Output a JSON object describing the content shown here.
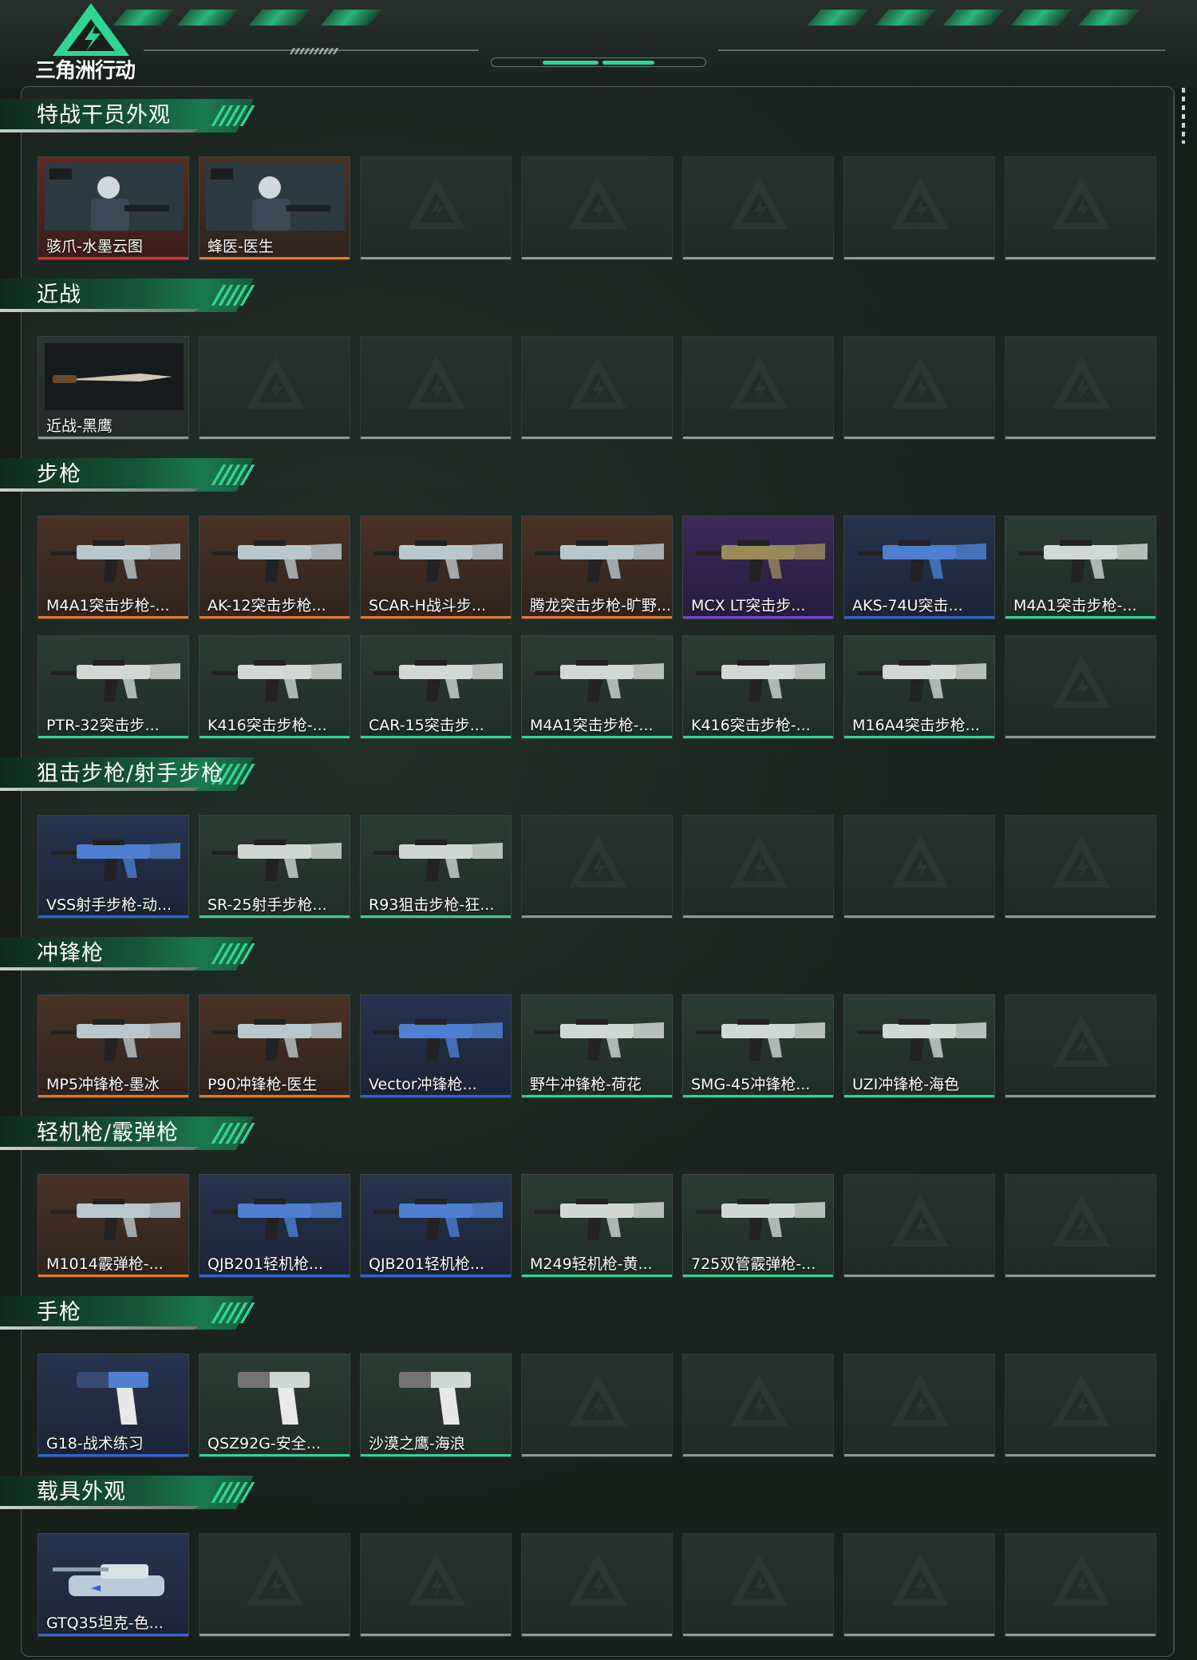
{
  "app": {
    "logo_text": "三角洲行动"
  },
  "colors": {
    "accent": "#2fd693",
    "rarity_red": "#d8302a",
    "rarity_orange": "#e8782a",
    "rarity_purple": "#7b3fe0",
    "rarity_blue": "#2a64d8",
    "rarity_green": "#2fd693",
    "rarity_gray": "#8e9894"
  },
  "sections": [
    {
      "title": "特战干员外观",
      "items": [
        {
          "label": "骇爪-水墨云图",
          "rarity": "red",
          "icon": "operator-portrait-icon"
        },
        {
          "label": "蜂医-医生",
          "rarity": "orange",
          "icon": "operator-portrait-icon"
        }
      ]
    },
    {
      "title": "近战",
      "items": [
        {
          "label": "近战-黑鹰",
          "rarity": "gray",
          "icon": "knife-icon"
        }
      ]
    },
    {
      "title": "步枪",
      "items": [
        {
          "label": "M4A1突击步枪-...",
          "rarity": "orange",
          "icon": "rifle-icon"
        },
        {
          "label": "AK-12突击步枪...",
          "rarity": "orange",
          "icon": "rifle-icon"
        },
        {
          "label": "SCAR-H战斗步...",
          "rarity": "orange",
          "icon": "rifle-icon"
        },
        {
          "label": "腾龙突击步枪-旷野...",
          "rarity": "orange",
          "icon": "rifle-icon"
        },
        {
          "label": "MCX LT突击步...",
          "rarity": "purple",
          "icon": "rifle-icon"
        },
        {
          "label": "AKS-74U突击...",
          "rarity": "blue",
          "icon": "rifle-icon"
        },
        {
          "label": "M4A1突击步枪-...",
          "rarity": "green",
          "icon": "rifle-icon"
        },
        {
          "label": "PTR-32突击步...",
          "rarity": "green",
          "icon": "rifle-icon"
        },
        {
          "label": "K416突击步枪-...",
          "rarity": "green",
          "icon": "rifle-icon"
        },
        {
          "label": "CAR-15突击步...",
          "rarity": "green",
          "icon": "rifle-icon"
        },
        {
          "label": "M4A1突击步枪-...",
          "rarity": "green",
          "icon": "rifle-icon"
        },
        {
          "label": "K416突击步枪-...",
          "rarity": "green",
          "icon": "rifle-icon"
        },
        {
          "label": "M16A4突击步枪...",
          "rarity": "green",
          "icon": "rifle-icon"
        }
      ]
    },
    {
      "title": "狙击步枪/射手步枪",
      "items": [
        {
          "label": "VSS射手步枪-动...",
          "rarity": "blue",
          "icon": "sniper-icon"
        },
        {
          "label": "SR-25射手步枪...",
          "rarity": "green",
          "icon": "sniper-icon"
        },
        {
          "label": "R93狙击步枪-狂...",
          "rarity": "green",
          "icon": "sniper-icon"
        }
      ]
    },
    {
      "title": "冲锋枪",
      "items": [
        {
          "label": "MP5冲锋枪-墨冰",
          "rarity": "orange",
          "icon": "smg-icon"
        },
        {
          "label": "P90冲锋枪-医生",
          "rarity": "orange",
          "icon": "smg-icon"
        },
        {
          "label": "Vector冲锋枪...",
          "rarity": "blue",
          "icon": "smg-icon"
        },
        {
          "label": "野牛冲锋枪-荷花",
          "rarity": "green",
          "icon": "smg-icon"
        },
        {
          "label": "SMG-45冲锋枪...",
          "rarity": "green",
          "icon": "smg-icon"
        },
        {
          "label": "UZI冲锋枪-海色",
          "rarity": "green",
          "icon": "smg-icon"
        }
      ]
    },
    {
      "title": "轻机枪/霰弹枪",
      "items": [
        {
          "label": "M1014霰弹枪-...",
          "rarity": "orange",
          "icon": "shotgun-icon"
        },
        {
          "label": "QJB201轻机枪...",
          "rarity": "blue",
          "icon": "lmg-icon"
        },
        {
          "label": "QJB201轻机枪...",
          "rarity": "blue",
          "icon": "lmg-icon"
        },
        {
          "label": "M249轻机枪-黄...",
          "rarity": "green",
          "icon": "lmg-icon"
        },
        {
          "label": "725双管霰弹枪-...",
          "rarity": "green",
          "icon": "shotgun-icon"
        }
      ]
    },
    {
      "title": "手枪",
      "items": [
        {
          "label": "G18-战术练习",
          "rarity": "blue",
          "icon": "pistol-icon"
        },
        {
          "label": "QSZ92G-安全...",
          "rarity": "green",
          "icon": "pistol-icon"
        },
        {
          "label": "沙漠之鹰-海浪",
          "rarity": "green",
          "icon": "pistol-icon"
        }
      ]
    },
    {
      "title": "载具外观",
      "items": [
        {
          "label": "GTQ35坦克-色...",
          "rarity": "blue",
          "icon": "tank-icon"
        }
      ]
    }
  ]
}
